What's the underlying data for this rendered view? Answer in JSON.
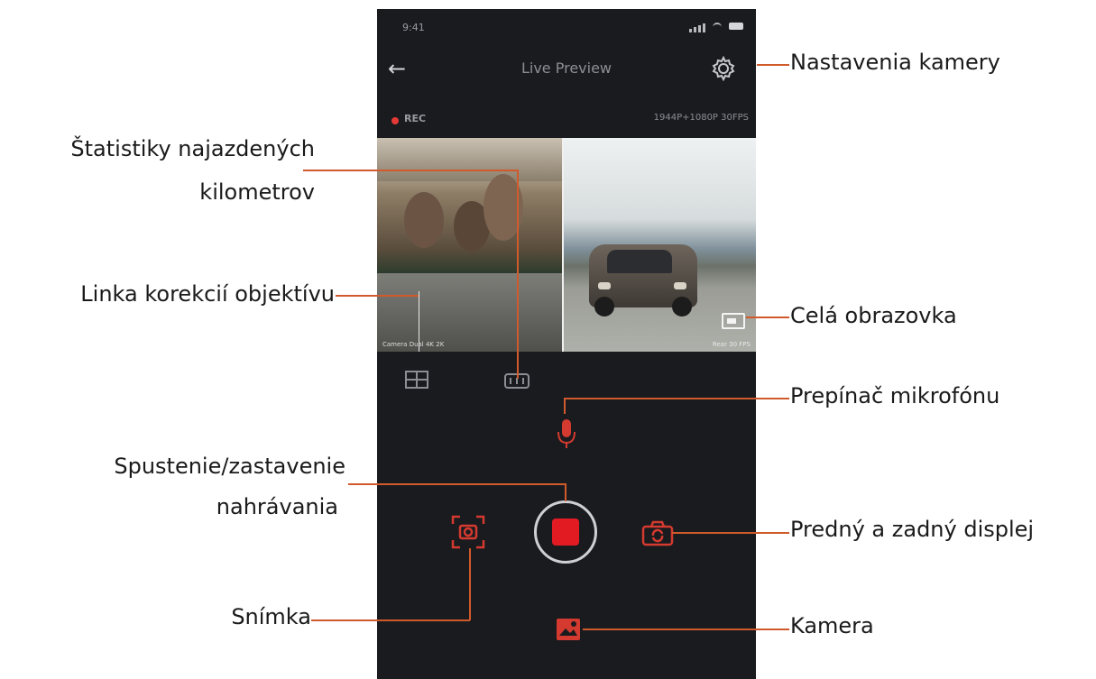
{
  "status_bar": {
    "time": "9:41"
  },
  "header": {
    "title": "Live Preview"
  },
  "recording": {
    "rec_label": "REC",
    "resolution": "1944P+1080P 30FPS"
  },
  "preview": {
    "front_osd": "Camera Dual 4K 2K",
    "rear_osd": "Rear 30 FPS"
  },
  "callouts": {
    "camera_settings": "Nastavenia kamery",
    "mileage_stats_line1": "Štatistiky najazdených",
    "mileage_stats_line2": "kilometrov",
    "lens_correction": "Linka korekcií objektívu",
    "fullscreen": "Celá obrazovka",
    "mic_toggle": "Prepínač mikrofónu",
    "record_line1": "Spustenie/zastavenie",
    "record_line2": "nahrávania",
    "front_rear_display": "Predný a zadný displej",
    "snapshot": "Snímka",
    "camera": "Kamera"
  },
  "colors": {
    "accent": "#d43a2f",
    "record": "#e21b23",
    "callout_line": "#d15a2c",
    "background": "#1a1b1f"
  },
  "icons": [
    "back-arrow-icon",
    "gear-icon",
    "grid-icon",
    "odometer-icon",
    "microphone-icon",
    "record-button",
    "snapshot-icon",
    "camera-switch-icon",
    "gallery-icon",
    "fullscreen-icon"
  ]
}
